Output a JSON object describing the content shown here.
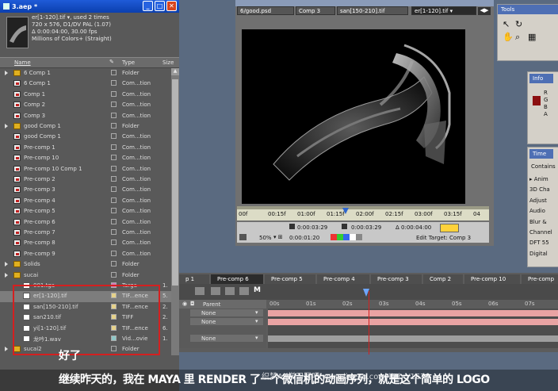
{
  "project": {
    "title": "3.aep *",
    "info": [
      "er[1-120].tif ▾, used 2 times",
      "720 x 576, D1/DV PAL (1.07)",
      "Δ 0:00:04:00, 30.00 fps",
      "Millions of Colors+ (Straight)"
    ],
    "col_name": "Name",
    "col_type": "Type",
    "col_size": "Size",
    "items": [
      {
        "name": "6 Comp 1",
        "type": "Folder",
        "size": "",
        "icon": "folder",
        "twirl": true
      },
      {
        "name": "6 Comp 1",
        "type": "Com...tion",
        "size": "",
        "icon": "comp",
        "twirl": false
      },
      {
        "name": "Comp 1",
        "type": "Com...tion",
        "size": "",
        "icon": "comp",
        "twirl": false
      },
      {
        "name": "Comp 2",
        "type": "Com...tion",
        "size": "",
        "icon": "comp",
        "twirl": false
      },
      {
        "name": "Comp 3",
        "type": "Com...tion",
        "size": "",
        "icon": "comp",
        "twirl": false
      },
      {
        "name": "good Comp 1",
        "type": "Folder",
        "size": "",
        "icon": "folder",
        "twirl": true
      },
      {
        "name": "good Comp 1",
        "type": "Com...tion",
        "size": "",
        "icon": "comp",
        "twirl": false
      },
      {
        "name": "Pre-comp 1",
        "type": "Com...tion",
        "size": "",
        "icon": "comp",
        "twirl": false
      },
      {
        "name": "Pre-comp 10",
        "type": "Com...tion",
        "size": "",
        "icon": "comp",
        "twirl": false
      },
      {
        "name": "Pre-comp 10 Comp 1",
        "type": "Com...tion",
        "size": "",
        "icon": "comp",
        "twirl": false
      },
      {
        "name": "Pre-comp 2",
        "type": "Com...tion",
        "size": "",
        "icon": "comp",
        "twirl": false
      },
      {
        "name": "Pre-comp 3",
        "type": "Com...tion",
        "size": "",
        "icon": "comp",
        "twirl": false
      },
      {
        "name": "Pre-comp 4",
        "type": "Com...tion",
        "size": "",
        "icon": "comp",
        "twirl": false
      },
      {
        "name": "Pre-comp 5",
        "type": "Com...tion",
        "size": "",
        "icon": "comp",
        "twirl": false
      },
      {
        "name": "Pre-comp 6",
        "type": "Com...tion",
        "size": "",
        "icon": "comp",
        "twirl": false
      },
      {
        "name": "Pre-comp 7",
        "type": "Com...tion",
        "size": "",
        "icon": "comp",
        "twirl": false
      },
      {
        "name": "Pre-comp 8",
        "type": "Com...tion",
        "size": "",
        "icon": "comp",
        "twirl": false
      },
      {
        "name": "Pre-comp 9",
        "type": "Com...tion",
        "size": "",
        "icon": "comp",
        "twirl": false
      },
      {
        "name": "Solids",
        "type": "Folder",
        "size": "",
        "icon": "folder",
        "twirl": true
      },
      {
        "name": "sucai",
        "type": "Folder",
        "size": "",
        "icon": "folder",
        "twirl": true
      },
      {
        "name": "001.tga",
        "type": "Targa",
        "size": "1.",
        "icon": "file",
        "twirl": false
      },
      {
        "name": "er[1-120].tif",
        "type": "TIF...ence",
        "size": "5.",
        "icon": "file",
        "twirl": false
      },
      {
        "name": "san[150-210].tif",
        "type": "TIF...ence",
        "size": "2.",
        "icon": "file",
        "twirl": false
      },
      {
        "name": "san210.tif",
        "type": "TIFF",
        "size": "2.",
        "icon": "file",
        "twirl": false
      },
      {
        "name": "yi[1-120].tif",
        "type": "TIF...ence",
        "size": "6.",
        "icon": "file",
        "twirl": false
      },
      {
        "name": "龙吟1.wav",
        "type": "Vid...ovie",
        "size": "1.",
        "icon": "file",
        "twirl": false
      },
      {
        "name": "sucai2",
        "type": "Folder",
        "size": "",
        "icon": "folder",
        "twirl": true
      }
    ]
  },
  "comp_tabs": [
    "6/good.psd",
    "Comp 3",
    "san[150-210].tif",
    "er[1-120].tif ▾"
  ],
  "ruler": [
    "00f",
    "00:15f",
    "01:00f",
    "01:15f",
    "02:00f",
    "02:15f",
    "03:00f",
    "03:15f",
    "04"
  ],
  "viewer": {
    "current_time": "0:00:03:29",
    "delta_time": "Δ 0:00:04:00",
    "zoom": "50%",
    "time2": "0:00:01:20",
    "edit_target": "Edit Target: Comp 3"
  },
  "tools": {
    "title": "Tools"
  },
  "info_panel": {
    "title": "Info",
    "labels": [
      "R",
      "G",
      "B",
      "A"
    ]
  },
  "time_panel": {
    "title": "Time",
    "header": "Contains",
    "items": [
      "▸ Anim",
      "3D Cha",
      "Adjust",
      "Audio",
      "Blur &",
      "Channel",
      "DFT 55",
      "Digital"
    ]
  },
  "timeline": {
    "tabs": [
      "p 1",
      "Pre-comp 6",
      "Pre-comp 5",
      "Pre-comp 4",
      "Pre-comp 3",
      "Comp 2",
      "Pre-comp 10",
      "Pre-comp"
    ],
    "active_tab": 1,
    "parent_label": "Parent",
    "none_label": "None",
    "ticks": [
      "00s",
      "01s",
      "02s",
      "03s",
      "04s",
      "05s",
      "06s",
      "07s"
    ]
  },
  "overlay": {
    "note": "好了",
    "subtitle": "继续昨天的，我在 MAYA 里 RENDER 了一个微信机的动画序列，就是这个简单的 LOGO",
    "watermark": "织梦AE学习网吧 www.lineco.com/liebc/1675"
  },
  "colors": {
    "highlight": "#d42020",
    "accent": "#1f5bd8",
    "track": "#e9a3a3"
  }
}
